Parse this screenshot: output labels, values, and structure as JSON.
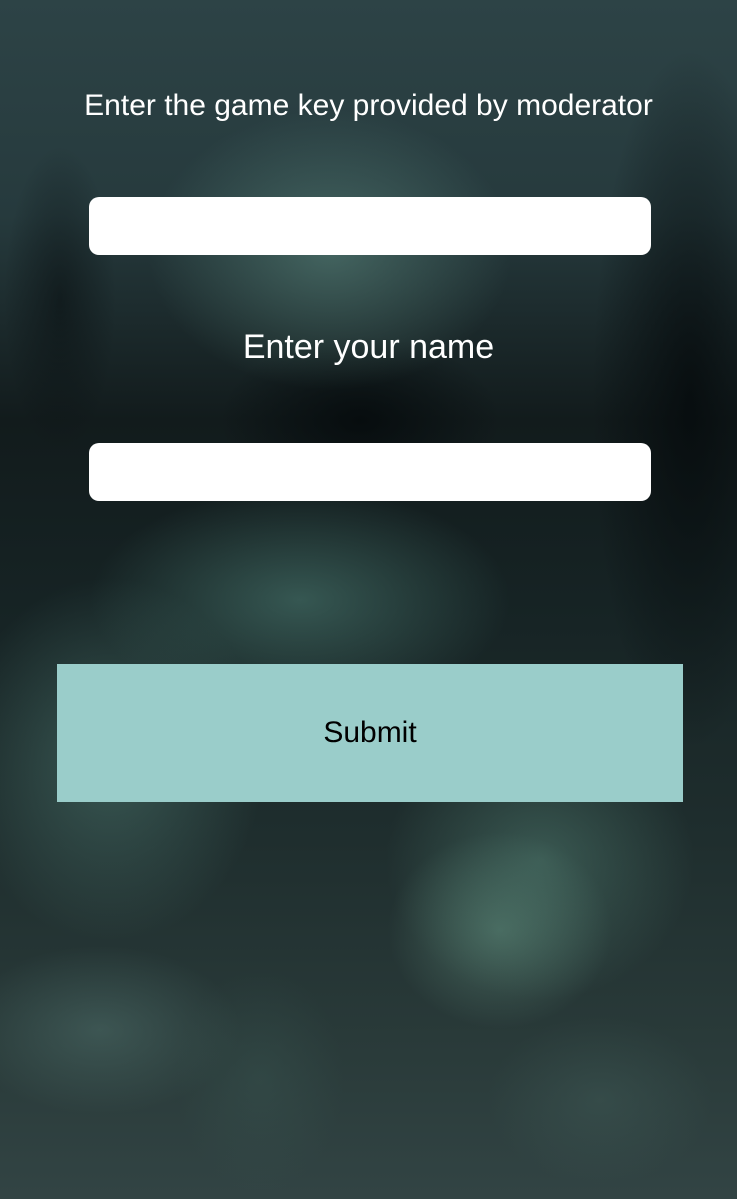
{
  "form": {
    "game_key_label": "Enter the game key provided by moderator",
    "game_key_value": "",
    "name_label": "Enter your name",
    "name_value": "",
    "submit_label": "Submit"
  },
  "colors": {
    "submit_background": "#9acdca",
    "label_text": "#ffffff"
  }
}
